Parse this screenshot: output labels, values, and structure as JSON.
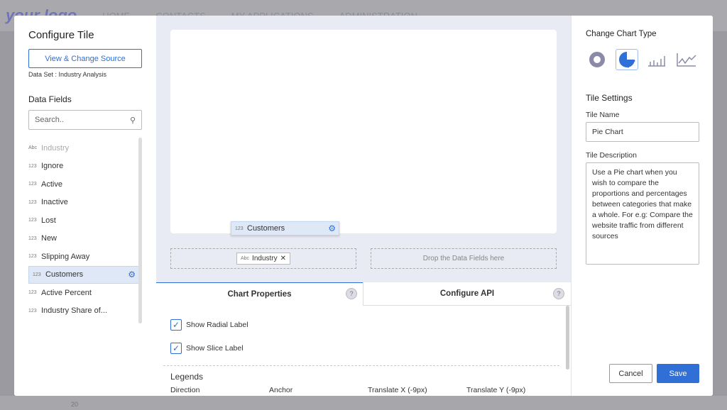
{
  "background": {
    "logo": "your logo",
    "nav": [
      "HOME",
      "CONTACTS",
      "MY APPLICATIONS",
      "ADMINISTRATION"
    ],
    "axis_tick": "20"
  },
  "left": {
    "title": "Configure Tile",
    "source_button": "View & Change Source",
    "dataset": "Data Set : Industry Analysis",
    "fields_title": "Data Fields",
    "search_placeholder": "Search..",
    "fields": [
      {
        "type": "Abc",
        "label": "Industry"
      },
      {
        "type": "123",
        "label": "Ignore"
      },
      {
        "type": "123",
        "label": "Active"
      },
      {
        "type": "123",
        "label": "Inactive"
      },
      {
        "type": "123",
        "label": "Lost"
      },
      {
        "type": "123",
        "label": "New"
      },
      {
        "type": "123",
        "label": "Slipping Away"
      },
      {
        "type": "123",
        "label": "Customers"
      },
      {
        "type": "123",
        "label": "Active Percent"
      },
      {
        "type": "123",
        "label": "Industry Share of..."
      }
    ]
  },
  "middle": {
    "dragging": {
      "type": "123",
      "label": "Customers"
    },
    "drop_x": {
      "type": "Abc",
      "label": "Industry"
    },
    "drop_y_placeholder": "Drop the Data Fields here",
    "tabs": [
      "Chart Properties",
      "Configure API"
    ],
    "checkboxes": [
      {
        "label": "Show Radial Label",
        "checked": true
      },
      {
        "label": "Show Slice Label",
        "checked": true
      }
    ],
    "legends_title": "Legends",
    "legend_columns": [
      "Direction",
      "Anchor",
      "Translate X (-9px)",
      "Translate Y (-9px)"
    ]
  },
  "right": {
    "chart_type_title": "Change Chart Type",
    "chart_types": [
      "donut",
      "pie",
      "bar",
      "line"
    ],
    "selected_type": "pie",
    "settings_title": "Tile Settings",
    "name_label": "Tile Name",
    "name_value": "Pie Chart",
    "desc_label": "Tile Description",
    "desc_value": "Use a Pie chart when you wish to compare the proportions and percentages between categories that make a whole. For e.g: Compare the website traffic from different sources",
    "cancel": "Cancel",
    "save": "Save"
  },
  "colors": {
    "accent": "#2f6fd6",
    "icon": "#8b8ba8"
  }
}
